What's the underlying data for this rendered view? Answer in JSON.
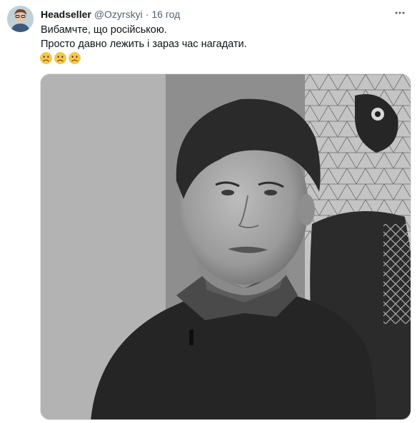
{
  "tweet": {
    "display_name": "Headseller",
    "handle": "@Ozyrskyi",
    "separator": "·",
    "time": "16 год",
    "text_lines": [
      "Вибамчте, що російською.",
      "Просто давно лежить і зараз час нагадати."
    ],
    "emojis": [
      "slightly-frowning-face",
      "slightly-frowning-face",
      "slightly-frowning-face"
    ],
    "media": {
      "kind": "video-still",
      "color_mode": "grayscale"
    }
  },
  "icons": {
    "more": "more-horizontal-icon"
  },
  "colors": {
    "text_primary": "#0f1419",
    "text_secondary": "#536471",
    "emoji_face": "#f7c64a",
    "media_border": "#e1e6ea"
  }
}
